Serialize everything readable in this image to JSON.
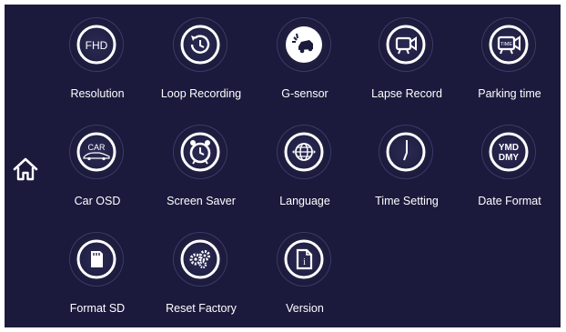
{
  "menu": {
    "home_icon": "home-icon",
    "items": [
      {
        "label": "Resolution",
        "icon": "fhd-icon",
        "icon_text": "FHD"
      },
      {
        "label": "Loop Recording",
        "icon": "loop-recording-icon"
      },
      {
        "label": "G-sensor",
        "icon": "g-sensor-car-crash-icon"
      },
      {
        "label": "Lapse Record",
        "icon": "lapse-record-camera-icon"
      },
      {
        "label": "Parking time",
        "icon": "parking-time-camera-icon",
        "icon_text": "TIME"
      },
      {
        "label": "Car OSD",
        "icon": "car-osd-icon",
        "icon_text": "CAR"
      },
      {
        "label": "Screen Saver",
        "icon": "alarm-clock-icon"
      },
      {
        "label": "Language",
        "icon": "globe-icon"
      },
      {
        "label": "Time Setting",
        "icon": "clock-icon"
      },
      {
        "label": "Date Format",
        "icon": "date-format-icon",
        "icon_text_top": "YMD",
        "icon_text_bottom": "DMY"
      },
      {
        "label": "Format SD",
        "icon": "sd-card-icon"
      },
      {
        "label": "Reset Factory",
        "icon": "gears-icon"
      },
      {
        "label": "Version",
        "icon": "version-document-icon",
        "icon_text": "i"
      }
    ]
  },
  "colors": {
    "background": "#1b1a3d",
    "icon_white": "#ffffff",
    "ring_dark": "#14132e"
  }
}
